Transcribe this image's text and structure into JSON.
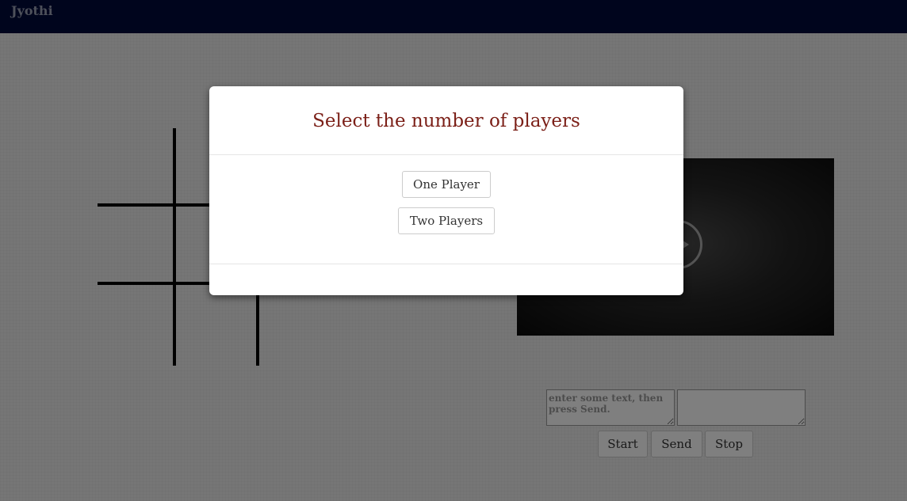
{
  "navbar": {
    "brand": "Jyothi"
  },
  "video": {
    "icon": "play-icon"
  },
  "chat": {
    "send_placeholder": "enter some text, then press Send.",
    "send_value": "",
    "receive_value": "",
    "start_label": "Start",
    "send_label": "Send",
    "stop_label": "Stop"
  },
  "modal": {
    "title": "Select the number of players",
    "one_player_label": "One Player",
    "two_players_label": "Two Players"
  },
  "colors": {
    "navbar": "#000b3a",
    "modal_title": "#7b1f17"
  }
}
